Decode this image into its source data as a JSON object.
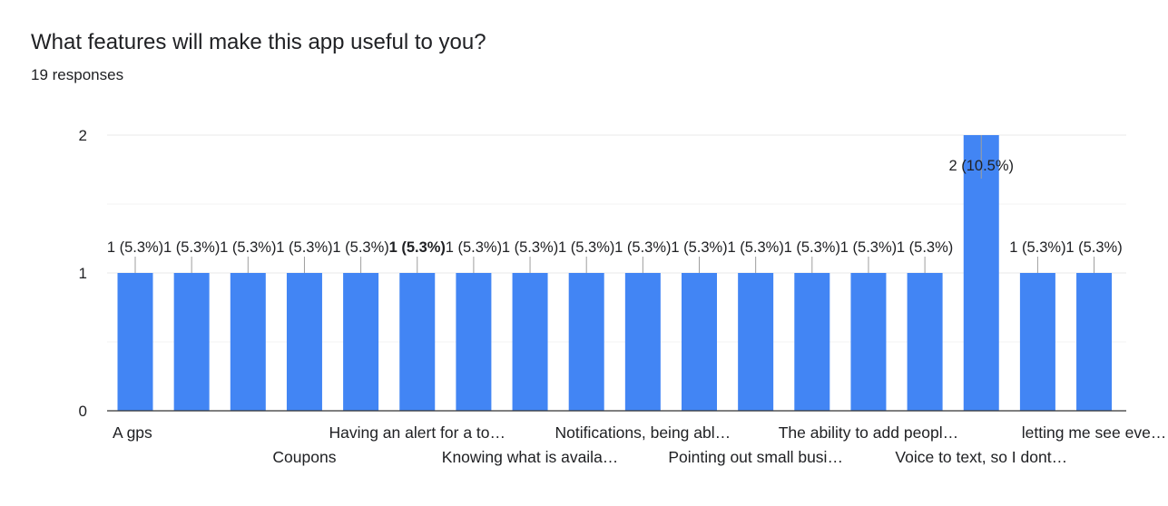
{
  "header": {
    "title": "What features will make this app useful to you?",
    "responses": "19 responses"
  },
  "colors": {
    "bar": "#4285f4",
    "grid": "#e8e8e8",
    "axis": "#333333",
    "text": "#202124"
  },
  "chart_data": {
    "type": "bar",
    "title": "What features will make this app useful to you?",
    "xlabel": "",
    "ylabel": "",
    "ylim": [
      0,
      2
    ],
    "yticks": [
      0,
      1,
      2
    ],
    "grid": true,
    "categories": [
      "A gps",
      "Coupons",
      "Having an alert for a to…",
      "Knowing what is availa…",
      "Notifications, being abl…",
      "Pointing out small busi…",
      "The ability to add peopl…",
      "Voice to text, so I dont…",
      "letting me see eve…"
    ],
    "values": [
      1,
      1,
      1,
      1,
      1,
      1,
      1,
      1,
      1,
      1,
      1,
      1,
      1,
      1,
      1,
      2,
      1,
      1
    ],
    "data_labels": [
      "1 (5.3%)",
      "1 (5.3%)",
      "1 (5.3%)",
      "1 (5.3%)",
      "1 (5.3%)",
      "1 (5.3%)",
      "1 (5.3%)",
      "1 (5.3%)",
      "1 (5.3%)",
      "1 (5.3%)",
      "1 (5.3%)",
      "1 (5.3%)",
      "1 (5.3%)",
      "1 (5.3%)",
      "1 (5.3%)",
      "2 (10.5%)",
      "1 (5.3%)",
      "1 (5.3%)"
    ]
  }
}
